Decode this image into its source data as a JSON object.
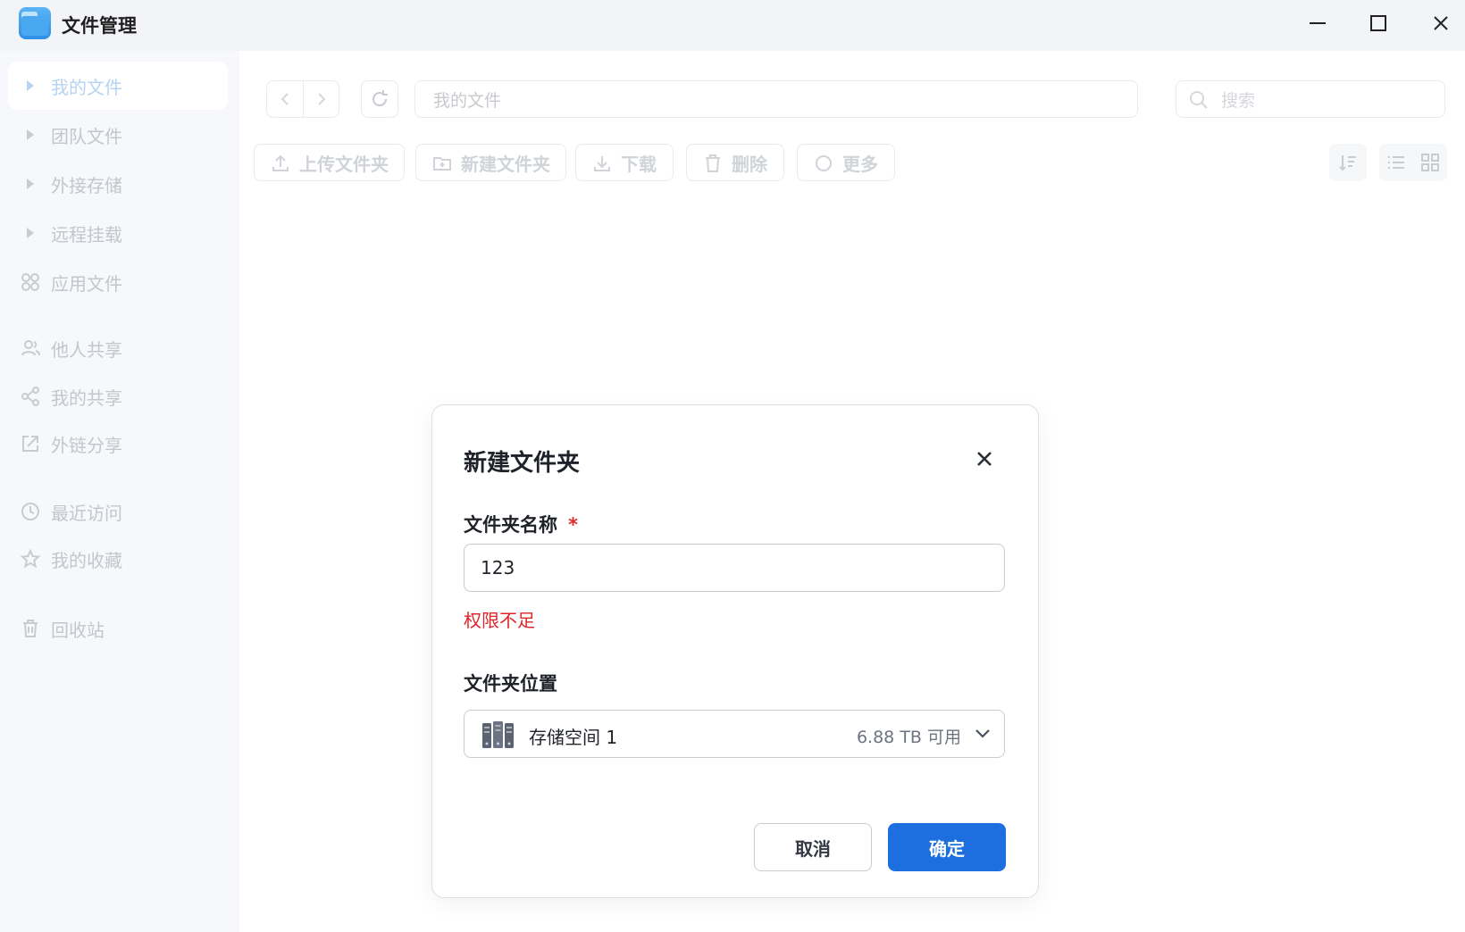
{
  "window": {
    "title": "文件管理",
    "logo_icon": "folder-app-icon"
  },
  "sidebar": {
    "items": [
      {
        "label": "我的文件",
        "icon": "caret-right-icon",
        "active": true
      },
      {
        "label": "团队文件",
        "icon": "caret-right-icon"
      },
      {
        "label": "外接存储",
        "icon": "caret-right-icon"
      },
      {
        "label": "远程挂载",
        "icon": "caret-right-icon"
      },
      {
        "label": "应用文件",
        "icon": "apps-icon"
      },
      {
        "label": "他人共享",
        "icon": "users-icon"
      },
      {
        "label": "我的共享",
        "icon": "share-icon"
      },
      {
        "label": "外链分享",
        "icon": "external-link-icon"
      },
      {
        "label": "最近访问",
        "icon": "clock-icon"
      },
      {
        "label": "我的收藏",
        "icon": "star-icon"
      },
      {
        "label": "回收站",
        "icon": "trash-icon"
      }
    ]
  },
  "toolbar": {
    "path": "我的文件",
    "search_placeholder": "搜索",
    "upload_folder": "上传文件夹",
    "new_folder": "新建文件夹",
    "download": "下载",
    "delete": "删除",
    "more": "更多"
  },
  "dialog": {
    "title": "新建文件夹",
    "name_label": "文件夹名称",
    "required_mark": "*",
    "name_value": "123",
    "error": "权限不足",
    "location_label": "文件夹位置",
    "location_name": "存储空间 1",
    "location_free": "6.88 TB 可用",
    "cancel": "取消",
    "confirm": "确定"
  },
  "colors": {
    "accent": "#1d6fe0",
    "error": "#e0242b"
  }
}
